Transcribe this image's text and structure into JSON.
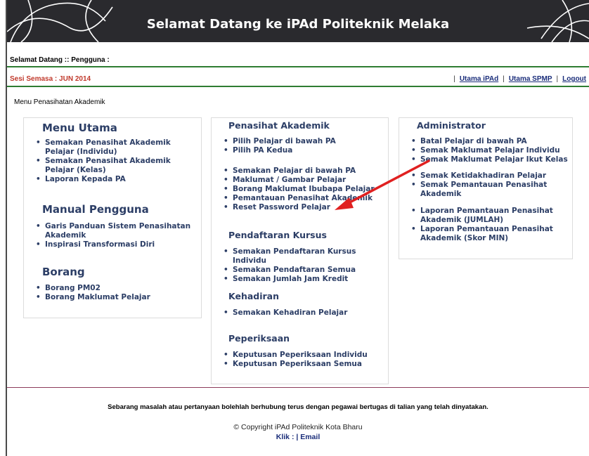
{
  "banner": {
    "title": "Selamat Datang ke iPAd Politeknik Melaka"
  },
  "header": {
    "welcome": "Selamat Datang :: Pengguna :",
    "sesi": "Sesi Semasa : JUN 2014",
    "links": [
      "Utama iPAd",
      "Utama SPMP",
      "Logout"
    ]
  },
  "menu_heading": "Menu Penasihatan Akademik",
  "left_panel": {
    "sections": [
      {
        "title": "Menu Utama",
        "items": [
          "Semakan Penasihat Akademik Pelajar (Individu)",
          "Semakan Penasihat Akademik Pelajar (Kelas)",
          "Laporan Kepada PA"
        ]
      },
      {
        "title": "Manual Pengguna",
        "items": [
          "Garis Panduan Sistem Penasihatan Akademik",
          "Inspirasi Transformasi Diri"
        ]
      },
      {
        "title": "Borang",
        "items": [
          "Borang PM02",
          "Borang Maklumat Pelajar"
        ]
      }
    ]
  },
  "middle_panel": {
    "sections": [
      {
        "title": "Penasihat Akademik",
        "items": [
          "Pilih Pelajar di bawah PA",
          "Pilih PA Kedua"
        ],
        "items2": [
          "Semakan Pelajar di bawah PA",
          "Maklumat / Gambar Pelajar",
          "Borang Maklumat Ibubapa Pelajar",
          "Pemantauan Penasihat Akademik",
          "Reset Password Pelajar"
        ]
      },
      {
        "title": "Pendaftaran Kursus",
        "items": [
          "Semakan Pendaftaran Kursus Individu",
          "Semakan Pendaftaran Semua",
          "Semakan Jumlah Jam Kredit"
        ]
      },
      {
        "title": "Kehadiran",
        "items": [
          "Semakan Kehadiran Pelajar"
        ]
      },
      {
        "title": "Peperiksaan",
        "items": [
          "Keputusan Peperiksaan Individu",
          "Keputusan Peperiksaan Semua"
        ]
      }
    ]
  },
  "right_panel": {
    "title": "Administrator",
    "items": [
      "Batal Pelajar di bawah PA",
      "Semak Maklumat Pelajar Individu",
      "Semak Maklumat Pelajar Ikut Kelas"
    ],
    "items2": [
      "Semak Ketidakhadiran Pelajar",
      "Semak Pemantauan Penasihat Akademik"
    ],
    "items3": [
      "Laporan Pemantauan Penasihat Akademik (JUMLAH)",
      "Laporan Pemantauan Penasihat Akademik (Skor MIN)"
    ]
  },
  "footer": {
    "notice": "Sebarang masalah atau pertanyaan bolehlah berhubung terus dengan pegawai bertugas di talian yang telah dinyatakan.",
    "copyright": "© Copyright iPAd Politeknik Kota Bharu",
    "klik_label": "Klik : |",
    "email_label": "Email"
  },
  "colors": {
    "banner_bg": "#2a2a2e",
    "accent_green": "#2e7d32",
    "sesi_red": "#c0392b",
    "menu_blue": "#2c3e66",
    "annotation_arrow": "#e02020"
  }
}
